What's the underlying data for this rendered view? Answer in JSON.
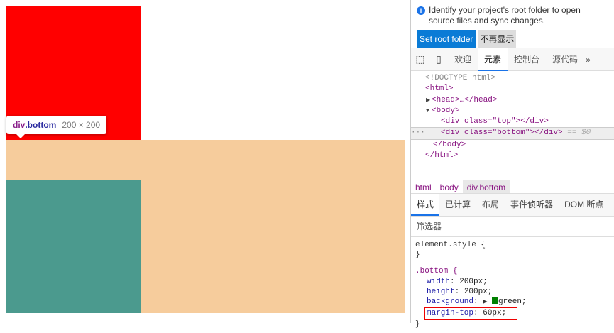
{
  "tooltip": {
    "selector_tag": "div",
    "selector_class": ".bottom",
    "size": "200 × 200"
  },
  "banner": {
    "message": "Identify your project's root folder to open source files and sync changes.",
    "primary": "Set root folder",
    "secondary": "不再显示"
  },
  "tabs": [
    "欢迎",
    "元素",
    "控制台",
    "源代码"
  ],
  "tabs_more": "»",
  "dom": {
    "doctype": "<!DOCTYPE html>",
    "html_open": "<html>",
    "head": "<head>…</head>",
    "body_open": "<body>",
    "div_top": "<div class=\"top\"></div>",
    "div_bottom": "<div class=\"bottom\"></div>",
    "selected_marker": "== $0",
    "body_close": "</body>",
    "html_close": "</html>",
    "ellipsis": "···"
  },
  "breadcrumb": [
    "html",
    "body",
    "div.bottom"
  ],
  "style_tabs": [
    "样式",
    "已计算",
    "布局",
    "事件侦听器",
    "DOM 断点"
  ],
  "filter_placeholder": "筛选器",
  "css": {
    "element_style": "element.style {",
    "close": "}",
    "rule_selector": ".bottom {",
    "decls": [
      {
        "prop": "width",
        "value": "200px;"
      },
      {
        "prop": "height",
        "value": "200px;"
      },
      {
        "prop": "background",
        "value": "green;"
      },
      {
        "prop": "margin-top",
        "value": "60px;"
      }
    ]
  },
  "colors": {
    "top": "#ff0000",
    "bottom": "#008000",
    "highlight_content": "#4b9a8e",
    "highlight_margin": "#f6cc9c"
  }
}
